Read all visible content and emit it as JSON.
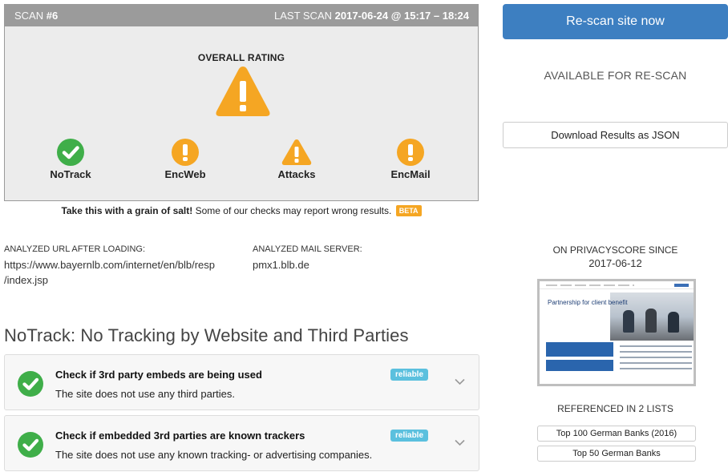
{
  "scan": {
    "label": "SCAN",
    "number": "#6",
    "last_scan_label": "LAST SCAN",
    "last_scan_value": "2017-06-24 @ 15:17 – 18:24",
    "overall_rating_label": "OVERALL RATING",
    "overall_rating_icon": "warning-triangle-icon",
    "categories": [
      {
        "label": "NoTrack",
        "icon": "check-circle-icon",
        "status": "good"
      },
      {
        "label": "EncWeb",
        "icon": "exclamation-circle-icon",
        "status": "warning"
      },
      {
        "label": "Attacks",
        "icon": "warning-triangle-icon",
        "status": "warning"
      },
      {
        "label": "EncMail",
        "icon": "exclamation-circle-icon",
        "status": "warning"
      }
    ]
  },
  "disclaimer": {
    "bold": "Take this with a grain of salt!",
    "text": " Some of our checks may report wrong results.",
    "badge": "BETA"
  },
  "actions": {
    "rescan_label": "Re-scan site now",
    "available_label": "AVAILABLE FOR RE-SCAN",
    "download_label": "Download Results as JSON"
  },
  "analyzed": {
    "url_label": "ANALYZED URL AFTER LOADING:",
    "url_line1": "https://www.bayernlb.com/internet/en/blb/resp",
    "url_line2": "/index.jsp",
    "mail_label": "ANALYZED MAIL SERVER:",
    "mail_value": "pmx1.blb.de"
  },
  "site_info": {
    "since_label": "ON PRIVACYSCORE SINCE",
    "since_date": "2017-06-12",
    "thumbnail_title": "Partnership for client benefit",
    "referenced_label": "REFERENCED IN 2 LISTS",
    "lists": [
      "Top 100 German Banks (2016)",
      "Top 50 German Banks"
    ]
  },
  "section": {
    "title": "NoTrack: No Tracking by Website and Third Parties",
    "checks": [
      {
        "title": "Check if 3rd party embeds are being used",
        "description": "The site does not use any third parties.",
        "badge": "reliable"
      },
      {
        "title": "Check if embedded 3rd parties are known trackers",
        "description": "The site does not use any known tracking- or advertising companies.",
        "badge": "reliable"
      }
    ]
  },
  "colors": {
    "good": "#3fae49",
    "warning": "#f5a623",
    "primary": "#3d7fc1",
    "badge": "#5bc0de",
    "panel_header": "#9b9b9b"
  }
}
